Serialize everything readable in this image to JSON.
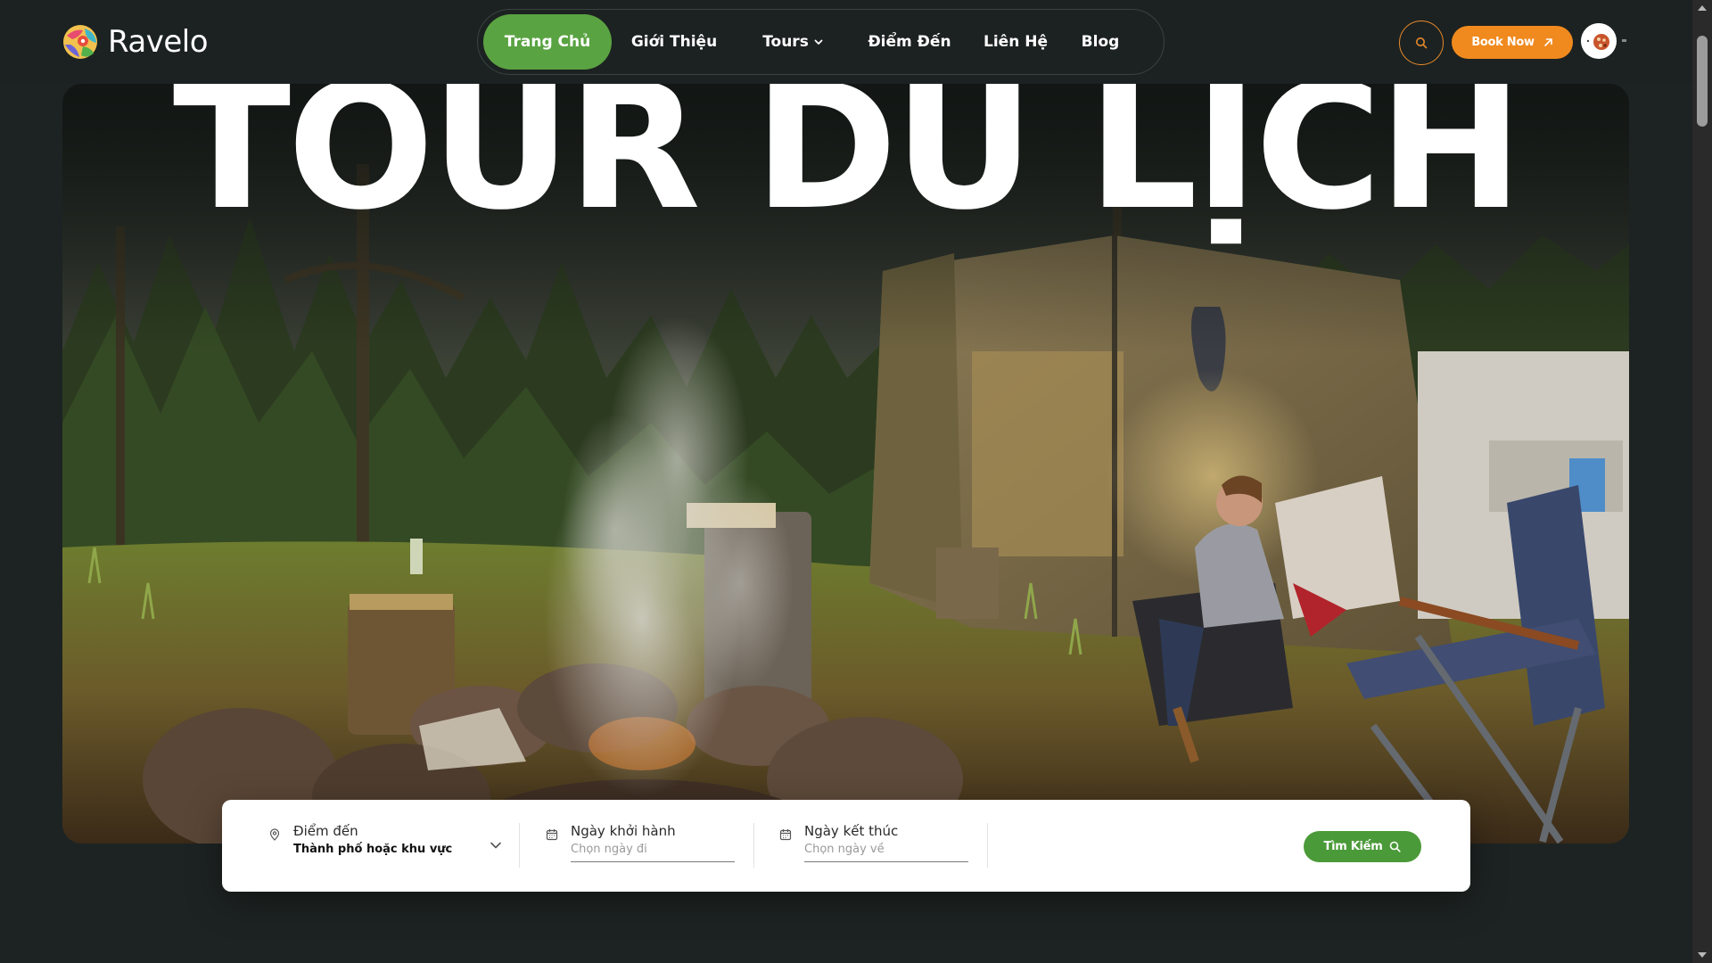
{
  "brand": {
    "name": "Ravelo"
  },
  "nav": {
    "items": [
      {
        "label": "Trang Chủ",
        "active": true
      },
      {
        "label": "Giới Thiệu"
      },
      {
        "label": "Tours",
        "has_dropdown": true
      },
      {
        "label": "Điểm Đến"
      },
      {
        "label": "Liên Hệ"
      },
      {
        "label": "Blog"
      }
    ]
  },
  "header_actions": {
    "search_icon": "search-icon",
    "book_label": "Book Now",
    "book_icon": "arrow-up-right-icon"
  },
  "hero": {
    "title": "TOUR DU LỊCH",
    "image": "campsite-campfire-woman-tent-forest"
  },
  "search": {
    "destination": {
      "label": "Điểm đến",
      "value": "Thành phố hoặc khu vực"
    },
    "start": {
      "label": "Ngày khởi hành",
      "placeholder": "Chọn ngày đi"
    },
    "end": {
      "label": "Ngày kết thúc",
      "placeholder": "Chọn ngày về"
    },
    "button_label": "Tìm Kiếm"
  },
  "colors": {
    "background": "#1d2322",
    "nav_active": "#5aa342",
    "book_button": "#f08a1f",
    "search_button": "#4b9a39"
  }
}
